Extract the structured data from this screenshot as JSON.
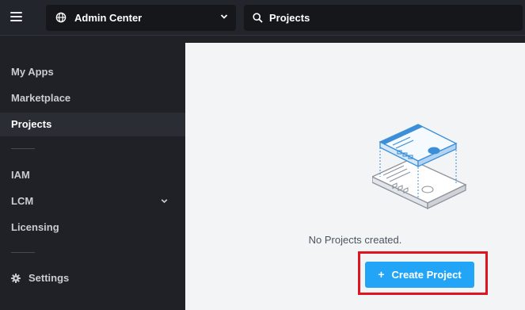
{
  "header": {
    "app_switcher_label": "Admin Center",
    "search_value": "Projects"
  },
  "sidebar": {
    "items": [
      {
        "label": "My Apps"
      },
      {
        "label": "Marketplace"
      },
      {
        "label": "Projects",
        "active": true
      },
      {
        "label": "IAM"
      },
      {
        "label": "LCM",
        "expandable": true
      },
      {
        "label": "Licensing"
      },
      {
        "label": "Settings",
        "icon": "gear-icon"
      }
    ]
  },
  "main": {
    "empty_message": "No Projects created.",
    "create_button_label": "Create Project",
    "create_button_icon": "+"
  },
  "colors": {
    "primary": "#22a5f7",
    "highlight_box": "#e0141e",
    "topbar_bg": "#22252b",
    "sidebar_bg": "#1f2127",
    "content_bg": "#f2f4f6"
  }
}
